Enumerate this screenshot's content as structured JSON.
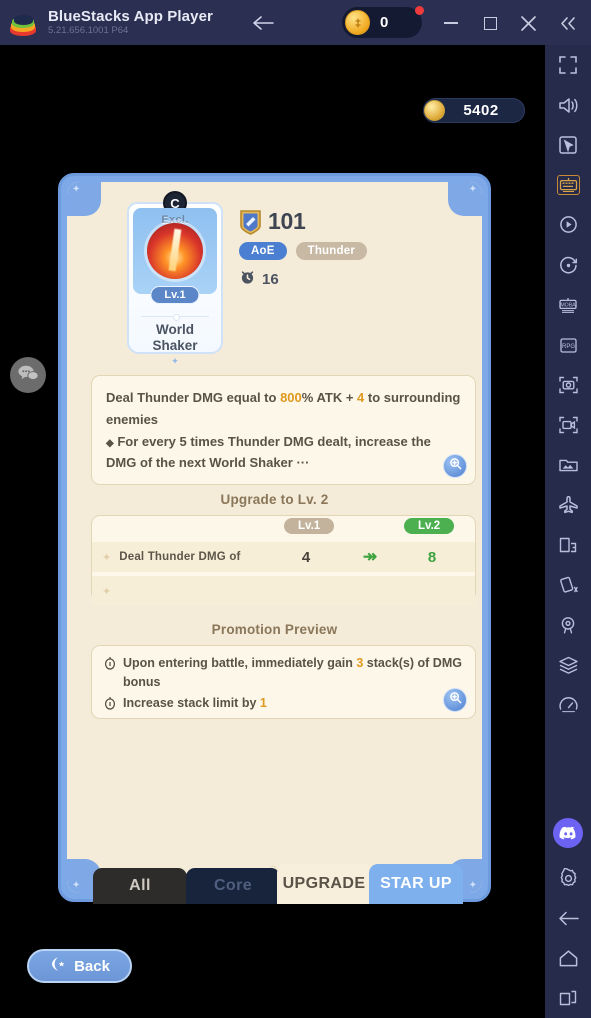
{
  "titlebar": {
    "app_name": "BlueStacks App Player",
    "version": "5.21.656.1001  P64",
    "back_icon": "arrow-left-icon",
    "coin_value": "0",
    "minimize_label": "",
    "maximize_label": "",
    "close_label": "✕",
    "collapse_label": "«"
  },
  "sidebar": {
    "items": [
      {
        "name": "fullscreen-icon"
      },
      {
        "name": "volume-icon"
      },
      {
        "name": "cursor-icon"
      },
      {
        "name": "keymapping-icon"
      },
      {
        "name": "macro-record-icon"
      },
      {
        "name": "rotate-icon"
      },
      {
        "name": "moba-mode-icon"
      },
      {
        "name": "rpg-mode-icon"
      },
      {
        "name": "screenshot-icon"
      },
      {
        "name": "record-video-icon"
      },
      {
        "name": "media-manager-icon"
      },
      {
        "name": "airplane-icon"
      },
      {
        "name": "multi-instance-icon"
      },
      {
        "name": "shake-icon"
      },
      {
        "name": "location-icon"
      },
      {
        "name": "layers-icon"
      },
      {
        "name": "performance-icon"
      },
      {
        "name": "discord-icon"
      },
      {
        "name": "settings-gear-icon"
      },
      {
        "name": "android-back-icon"
      },
      {
        "name": "android-home-icon"
      },
      {
        "name": "android-recents-icon"
      }
    ]
  },
  "game": {
    "currency": {
      "icon": "gold-coin-icon",
      "value": "5402"
    },
    "chat_fab": "chat-bubble-icon",
    "nav_prev": "‹",
    "nav_next": "›",
    "hero": {
      "class_letter": "C",
      "rarity_label": "Excl.",
      "level_badge": "Lv.1",
      "name_line1": "World",
      "name_line2": "Shaker"
    },
    "stats": {
      "power_icon": "shield-icon",
      "power": "101",
      "tags": [
        "AoE",
        "Thunder"
      ],
      "cooldown_icon": "clock-icon",
      "cooldown": "16"
    },
    "description": {
      "line1_a": "Deal Thunder DMG equal to ",
      "line1_hl1": "800",
      "line1_b": "% ATK + ",
      "line1_hl2": "4",
      "line1_c": " to surrounding enemies",
      "bullet": "◆",
      "line2": "For every 5 times Thunder DMG dealt, increase the DMG of the next World Shaker",
      "ellipsis": "···",
      "zoom_icon": "magnify-icon"
    },
    "upgrade": {
      "title": "Upgrade to Lv. 2",
      "chip_from": "Lv.1",
      "chip_to": "Lv.2",
      "arrow": "↠",
      "rows": [
        {
          "label": "Deal Thunder DMG of",
          "from": "4",
          "to": "8"
        },
        {
          "label": "",
          "from": "",
          "to": ""
        }
      ]
    },
    "promotion": {
      "title": "Promotion Preview",
      "icon": "promotion-badge-icon",
      "lines": [
        {
          "a": "Upon entering battle, immediately gain ",
          "hl": "3",
          "b": " stack(s) of DMG bonus"
        },
        {
          "a": "Increase stack limit by ",
          "hl": "1",
          "b": ""
        }
      ],
      "zoom_icon": "magnify-icon"
    },
    "tabs": [
      {
        "label": "All",
        "name": "tab-all"
      },
      {
        "label": "Core",
        "name": "tab-core"
      },
      {
        "label": "UPGRADE",
        "name": "tab-upgrade"
      },
      {
        "label": "STAR UP",
        "name": "tab-star-up"
      }
    ],
    "back_button": {
      "icon": "back-chevron-icon",
      "label": "Back"
    }
  },
  "colors": {
    "accent_blue": "#7ea9e8",
    "parchment": "#f4ecd9",
    "panel": "#fdf7e9",
    "highlight_gold": "#e0991f",
    "upgrade_green": "#3da33f",
    "titlebar": "#2b2f52",
    "sidebar": "#262a4b"
  }
}
